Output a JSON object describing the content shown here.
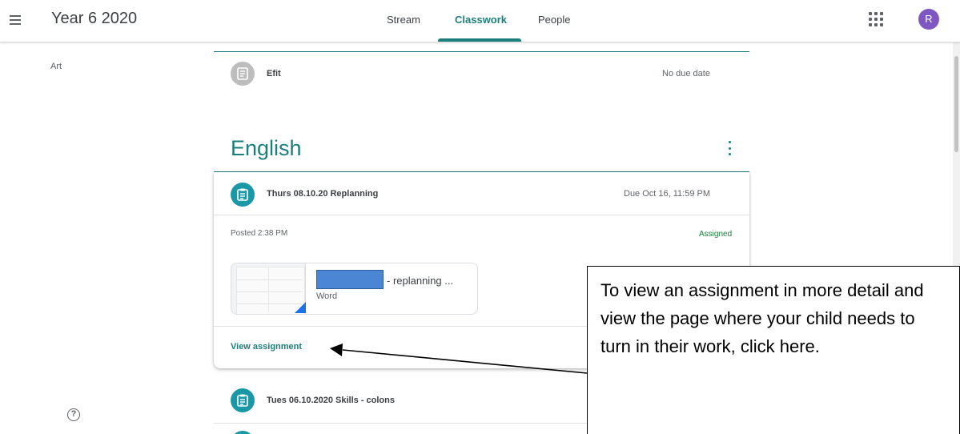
{
  "header": {
    "class_name": "Year 6 2020",
    "tabs": [
      {
        "label": "Stream"
      },
      {
        "label": "Classwork"
      },
      {
        "label": "People"
      }
    ],
    "active_tab": "Classwork",
    "avatar_initial": "R"
  },
  "sidebar": {
    "topic": "Art"
  },
  "items": {
    "efit": {
      "title": "Efit",
      "due": "No due date"
    }
  },
  "section": {
    "title": "English",
    "assignment": {
      "title": "Thurs 08.10.20 Replanning",
      "due": "Due Oct 16, 11:59 PM",
      "posted": "Posted 2:38 PM",
      "status": "Assigned",
      "attachment_name": "- replanning ...",
      "attachment_type": "Word",
      "view_label": "View assignment"
    },
    "next_item": {
      "title": "Tues 06.10.2020 Skills - colons"
    }
  },
  "annotation": {
    "text": "To view an assignment in more detail and view the page where your child needs to turn in their work, click here."
  },
  "colors": {
    "accent": "#1a7f7a",
    "assigned": "#188038",
    "avatar": "#7e57c2"
  },
  "icons": [
    "menu-icon",
    "apps-icon",
    "help-icon",
    "assignment-icon",
    "more-vert-icon"
  ]
}
